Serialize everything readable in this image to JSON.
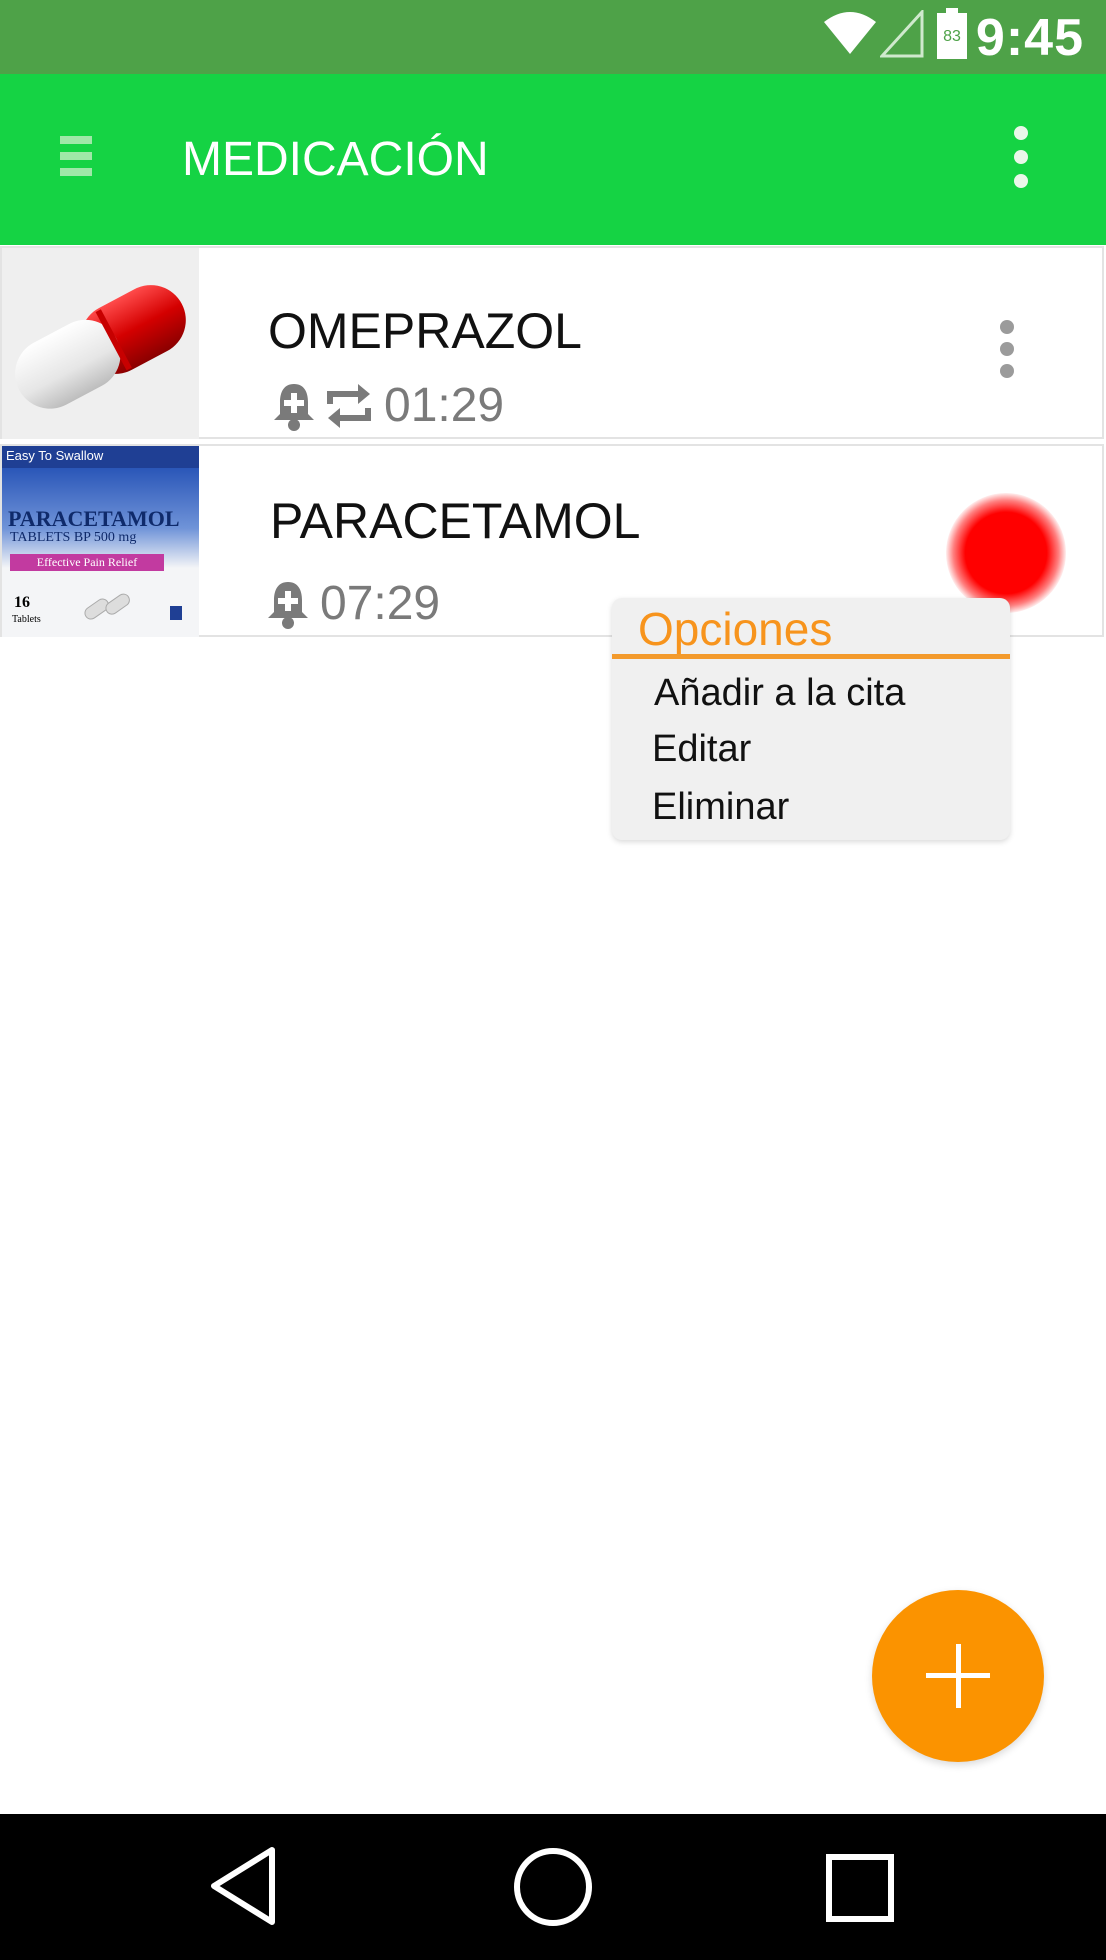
{
  "status_bar": {
    "time": "9:45",
    "battery_level": "83",
    "icons": [
      "wifi-icon",
      "cell-signal-icon",
      "battery-icon"
    ]
  },
  "app_bar": {
    "title": "MEDICACIÓN",
    "menu_icon": "hamburger-menu-icon",
    "overflow_icon": "more-vert-icon"
  },
  "medications": [
    {
      "name": "OMEPRAZOL",
      "time": "01:29",
      "has_alarm": true,
      "repeats": true,
      "image": "red-white-capsule"
    },
    {
      "name": "PARACETAMOL",
      "time": "07:29",
      "has_alarm": true,
      "repeats": false,
      "status_color": "#ff0000",
      "image": "paracetamol-box",
      "package_text": {
        "banner": "Easy To Swallow",
        "brand": "PARACETAMOL",
        "subtitle": "TABLETS BP 500 mg",
        "claim": "Effective Pain Relief",
        "count": "16",
        "count_unit": "Tablets"
      }
    }
  ],
  "context_menu": {
    "title": "Opciones",
    "items": [
      "Añadir a la cita",
      "Editar",
      "Eliminar"
    ]
  },
  "fab": {
    "icon": "plus-icon"
  },
  "nav_bar": {
    "icons": [
      "back-icon",
      "home-icon",
      "recents-icon"
    ]
  },
  "colors": {
    "status_bar": "#4ea248",
    "app_bar": "#15d344",
    "accent": "#fb9300",
    "menu_title": "#f7941d"
  }
}
